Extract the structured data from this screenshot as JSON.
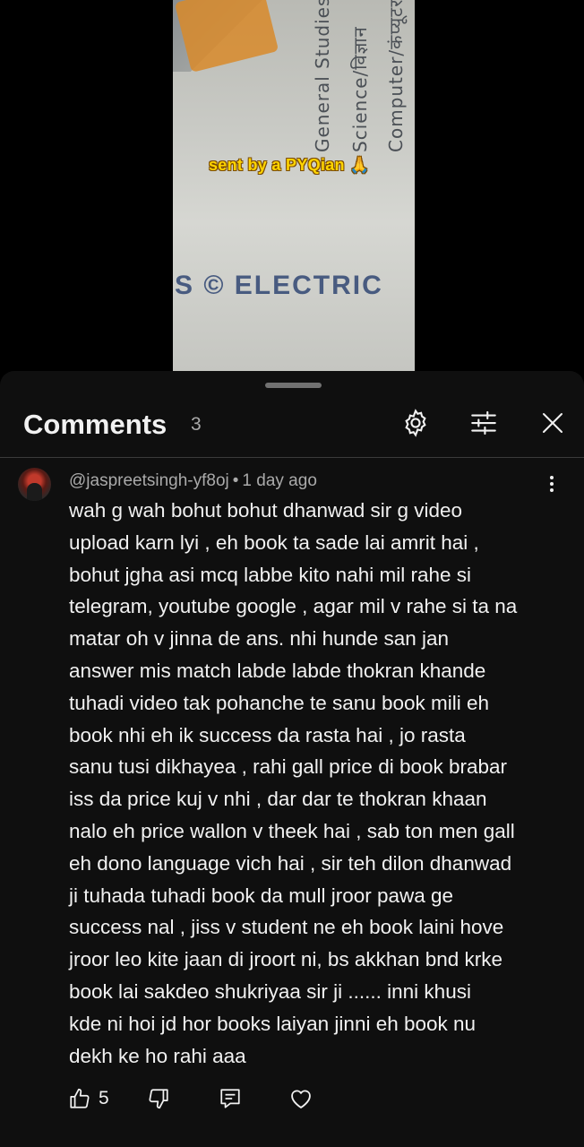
{
  "video": {
    "box_text_1": "General Studies",
    "box_text_2": "Science/विज्ञान",
    "box_text_3": "Computer/कंप्यूटर",
    "overlay_caption": "sent by a PYQian 🙏",
    "bottom_text": "S © ELECTRIC"
  },
  "comments_panel": {
    "title": "Comments",
    "count": "3"
  },
  "comment": {
    "author": "@jaspreetsingh-yf8oj",
    "separator": "•",
    "time": "1 day ago",
    "lines": [
      "wah g wah bohut bohut dhanwad sir g video",
      "upload karn lyi , eh book ta sade lai amrit hai ,",
      "bohut jgha asi mcq labbe kito nahi mil rahe si",
      "telegram, youtube google , agar mil v rahe si ta na",
      "matar oh v jinna de ans. nhi hunde san jan",
      "answer mis match labde labde thokran khande",
      "tuhadi video tak pohanche te sanu book mili eh",
      "book nhi eh ik success da rasta hai , jo rasta",
      "sanu tusi dikhayea , rahi gall price di book brabar",
      "iss da price kuj v nhi , dar dar te thokran khaan",
      "nalo eh price wallon v theek hai , sab ton men gall",
      "eh dono language vich hai , sir teh dilon dhanwad",
      "ji tuhada tuhadi book da mull jroor pawa ge",
      "success nal , jiss v student ne eh book laini hove",
      "jroor leo kite jaan di jroort ni, bs akkhan bnd krke",
      "book lai sakdeo  shukriyaa sir ji ...... inni khusi",
      "kde ni hoi jd hor books laiyan jinni eh book nu",
      "dekh ke ho rahi aaa"
    ],
    "like_count": "5"
  },
  "icons": {
    "settings": "gear-icon",
    "filter": "sliders-icon",
    "close": "close-icon",
    "more": "more-vertical-icon",
    "like": "thumbs-up-icon",
    "dislike": "thumbs-down-icon",
    "reply": "reply-icon",
    "heart": "heart-icon"
  },
  "colors": {
    "sheet_background": "#0f0f0f",
    "primary_text": "#f1f1f1",
    "secondary_text": "#aaaaaa",
    "caption_yellow": "#ffd400"
  }
}
